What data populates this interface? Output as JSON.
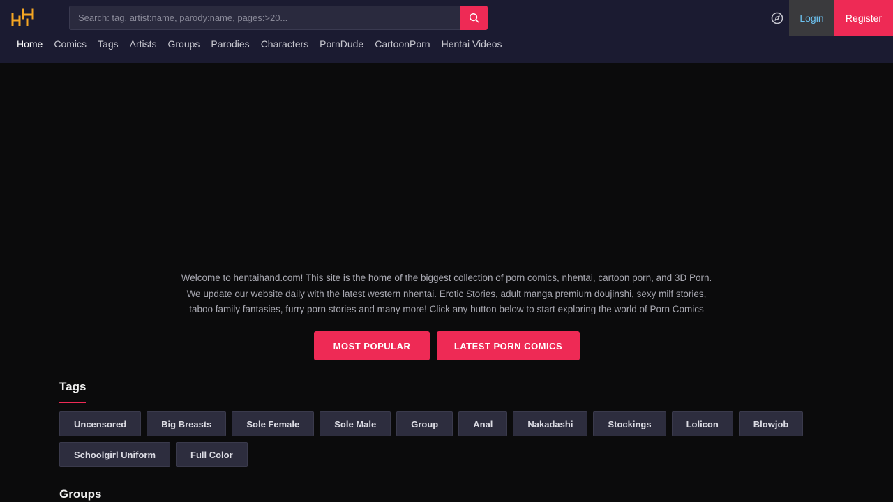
{
  "header": {
    "search": {
      "placeholder": "Search: tag, artist:name, parody:name, pages:>20..."
    },
    "login_label": "Login",
    "register_label": "Register"
  },
  "nav": [
    {
      "label": "Home"
    },
    {
      "label": "Comics"
    },
    {
      "label": "Tags"
    },
    {
      "label": "Artists"
    },
    {
      "label": "Groups"
    },
    {
      "label": "Parodies"
    },
    {
      "label": "Characters"
    },
    {
      "label": "PornDude"
    },
    {
      "label": "CartoonPorn"
    },
    {
      "label": "Hentai Videos"
    }
  ],
  "intro": {
    "line1": "Welcome to hentaihand.com! This site is the home of the biggest collection of porn comics, nhentai, cartoon porn, and 3D Porn.",
    "line2": "We update our website daily with the latest western nhentai. Erotic Stories, adult manga premium doujinshi, sexy milf stories,",
    "line3": "taboo family fantasies, furry porn stories and many more! Click any button below to start exploring the world of Porn Comics"
  },
  "buttons": {
    "most_popular": "MOST POPULAR",
    "latest": "LATEST PORN COMICS"
  },
  "tags_section": {
    "title": "Tags",
    "items": [
      "Uncensored",
      "Big Breasts",
      "Sole Female",
      "Sole Male",
      "Group",
      "Anal",
      "Nakadashi",
      "Stockings",
      "Lolicon",
      "Blowjob",
      "Schoolgirl Uniform",
      "Full Color"
    ]
  },
  "groups_section": {
    "title": "Groups"
  },
  "colors": {
    "accent": "#ee2a55",
    "header_bg": "#1b1b31",
    "page_bg": "#0b0b0c",
    "logo": "#f5a623"
  }
}
